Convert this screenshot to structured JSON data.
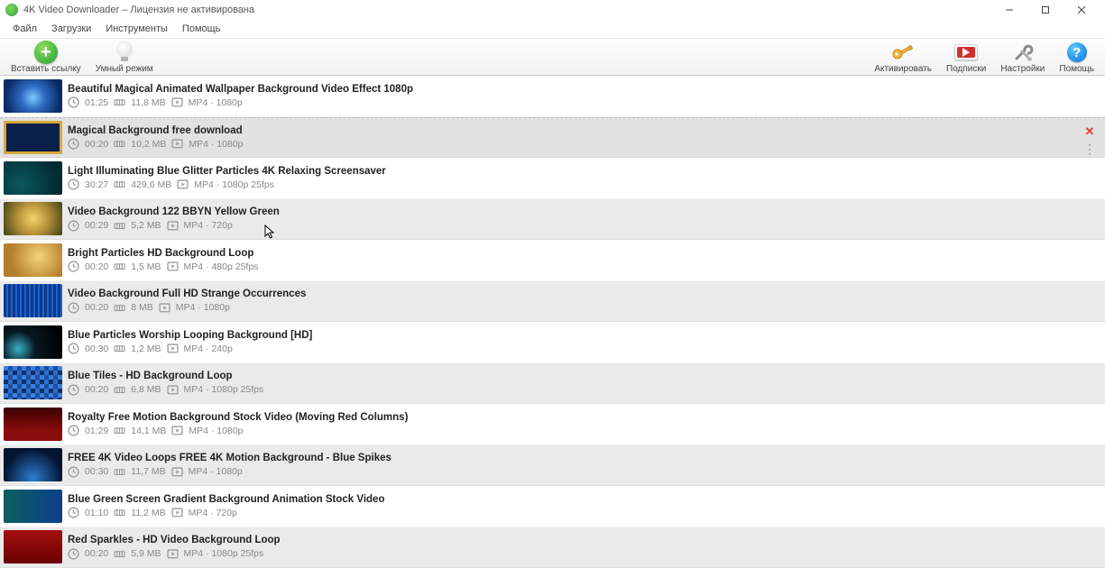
{
  "window": {
    "title": "4K Video Downloader – Лицензия не активирована"
  },
  "menu": {
    "file": "Файл",
    "downloads": "Загрузки",
    "tools": "Инструменты",
    "help": "Помощь"
  },
  "toolbar": {
    "paste": "Вставить ссылку",
    "smart": "Умный режим",
    "activate": "Активировать",
    "subscriptions": "Подписки",
    "settings": "Настройки",
    "helpBtn": "Помощь"
  },
  "rows": [
    {
      "title": "Beautiful Magical Animated Wallpaper Background Video Effect 1080p",
      "duration": "01:25",
      "size": "11,8 MB",
      "format": "MP4 · 1080p",
      "thumb": "th-blue-rays"
    },
    {
      "title": "Magical Background free download",
      "duration": "00:20",
      "size": "10,2 MB",
      "format": "MP4 · 1080p",
      "thumb": "th-gold-frame",
      "selected": true,
      "hasActions": true
    },
    {
      "title": "Light Illuminating Blue Glitter Particles   4K Relaxing Screensaver",
      "duration": "30:27",
      "size": "429,6 MB",
      "format": "MP4 · 1080p 25fps",
      "thumb": "th-teal-glitter"
    },
    {
      "title": "Video Background 122  BBYN Yellow Green",
      "duration": "00:29",
      "size": "5,2 MB",
      "format": "MP4 · 720p",
      "thumb": "th-yellow-green",
      "cursor": true
    },
    {
      "title": "Bright Particles   HD Background Loop",
      "duration": "00:20",
      "size": "1,5 MB",
      "format": "MP4 · 480p 25fps",
      "thumb": "th-gold-bokeh"
    },
    {
      "title": "Video Background Full HD Strange Occurrences",
      "duration": "00:20",
      "size": "8 MB",
      "format": "MP4 · 1080p",
      "thumb": "th-blue-stripes"
    },
    {
      "title": "Blue Particles  Worship Looping Background [HD]",
      "duration": "00:30",
      "size": "1,2 MB",
      "format": "MP4 · 240p",
      "thumb": "th-dark-bokeh"
    },
    {
      "title": "Blue Tiles - HD Background Loop",
      "duration": "00:20",
      "size": "6,8 MB",
      "format": "MP4 · 1080p 25fps",
      "thumb": "th-pixel-blue"
    },
    {
      "title": "Royalty Free Motion Background Stock Video (Moving Red Columns)",
      "duration": "01:29",
      "size": "14,1 MB",
      "format": "MP4 · 1080p",
      "thumb": "th-red-columns"
    },
    {
      "title": "FREE 4K Video Loops FREE 4K Motion Background -  Blue Spikes",
      "duration": "00:30",
      "size": "11,7 MB",
      "format": "MP4 · 1080p",
      "thumb": "th-blue-spikes"
    },
    {
      "title": "Blue Green Screen Gradient Background Animation Stock Video",
      "duration": "01:10",
      "size": "11,2 MB",
      "format": "MP4 · 720p",
      "thumb": "th-blue-green"
    },
    {
      "title": "Red Sparkles - HD Video Background Loop",
      "duration": "00:20",
      "size": "5,9 MB",
      "format": "MP4 · 1080p 25fps",
      "thumb": "th-red-sparkle"
    }
  ]
}
